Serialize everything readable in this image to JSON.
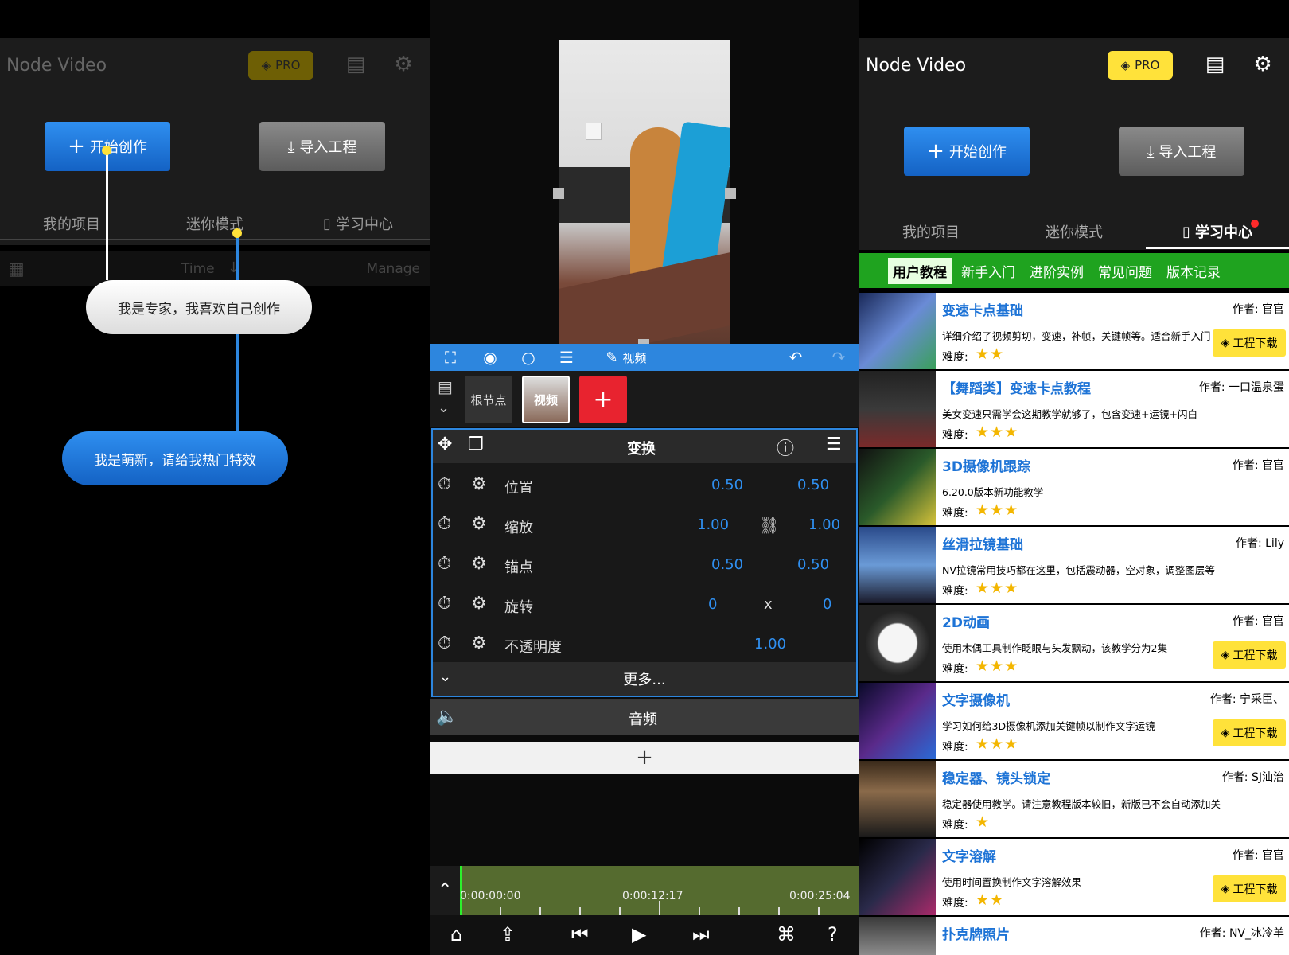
{
  "left_panel": {
    "app_name": "Node Video",
    "pro_label": "PRO",
    "start_button": "开始创作",
    "import_button": "导入工程",
    "tabs": [
      "我的项目",
      "迷你模式",
      "学习中心"
    ],
    "sort_label": "Time",
    "manage_label": "Manage",
    "bubble_expert": "我是专家，我喜欢自己创作",
    "bubble_newbie": "我是萌新，请给我热门特效"
  },
  "editor": {
    "toolbar_video_label": "视频",
    "node_root": "根节点",
    "node_video": "视频",
    "transform_title": "变换",
    "properties": [
      {
        "label": "位置",
        "v1": "0.50",
        "mid": "",
        "v2": "0.50"
      },
      {
        "label": "缩放",
        "v1": "1.00",
        "mid": "link",
        "v2": "1.00"
      },
      {
        "label": "锚点",
        "v1": "0.50",
        "mid": "",
        "v2": "0.50"
      },
      {
        "label": "旋转",
        "v1": "0",
        "mid": "x",
        "v2": "0"
      },
      {
        "label": "不透明度",
        "v1": "1.00",
        "mid": "",
        "v2": ""
      }
    ],
    "more_label": "更多...",
    "audio_label": "音频",
    "add_label": "+",
    "timecodes": [
      "0:00:00:00",
      "0:00:12:17",
      "0:00:25:04"
    ]
  },
  "right_panel": {
    "app_name": "Node Video",
    "pro_label": "PRO",
    "start_button": "开始创作",
    "import_button": "导入工程",
    "tabs": [
      "我的项目",
      "迷你模式",
      "学习中心"
    ],
    "categories": [
      "用户教程",
      "新手入门",
      "进阶实例",
      "常见问题",
      "版本记录"
    ],
    "difficulty_label": "难度:",
    "download_label": "工程下载",
    "tutorials": [
      {
        "title": "变速卡点基础",
        "author": "作者: 官官",
        "desc": "详细介绍了视频剪切，变速，补帧，关键帧等。适合新手入门",
        "stars": "★★",
        "download": true
      },
      {
        "title": "【舞蹈类】变速卡点教程",
        "author": "作者: 一口温泉蛋",
        "desc": "美女变速只需学会这期教学就够了，包含变速+运镜+闪白",
        "stars": "★★★",
        "download": false
      },
      {
        "title": "3D摄像机跟踪",
        "author": "作者: 官官",
        "desc": "6.20.0版本新功能教学",
        "stars": "★★★",
        "download": false
      },
      {
        "title": "丝滑拉镜基础",
        "author": "作者: Lily",
        "desc": "NV拉镜常用技巧都在这里，包括震动器，空对象，调整图层等",
        "stars": "★★★",
        "download": false
      },
      {
        "title": "2D动画",
        "author": "作者: 官官",
        "desc": "使用木偶工具制作眨眼与头发飘动，该教学分为2集",
        "stars": "★★★",
        "download": true
      },
      {
        "title": "文字摄像机",
        "author": "作者: 宁采臣、",
        "desc": "学习如何给3D摄像机添加关键帧以制作文字运镜",
        "stars": "★★★",
        "download": true
      },
      {
        "title": "稳定器、镜头锁定",
        "author": "作者: SJ汕治",
        "desc": "稳定器使用教学。请注意教程版本较旧，新版已不会自动添加关",
        "stars": "★",
        "download": false
      },
      {
        "title": "文字溶解",
        "author": "作者: 官官",
        "desc": "使用时间置换制作文字溶解效果",
        "stars": "★★",
        "download": true
      },
      {
        "title": "扑克牌照片",
        "author": "作者: NV_冰冷羊",
        "desc": "",
        "stars": "",
        "download": false
      }
    ]
  },
  "colors": {
    "accent_blue": "#2d86de",
    "pro_yellow": "#ffe23a",
    "green_bar": "#1fa31f",
    "title_blue": "#1d73d6"
  }
}
